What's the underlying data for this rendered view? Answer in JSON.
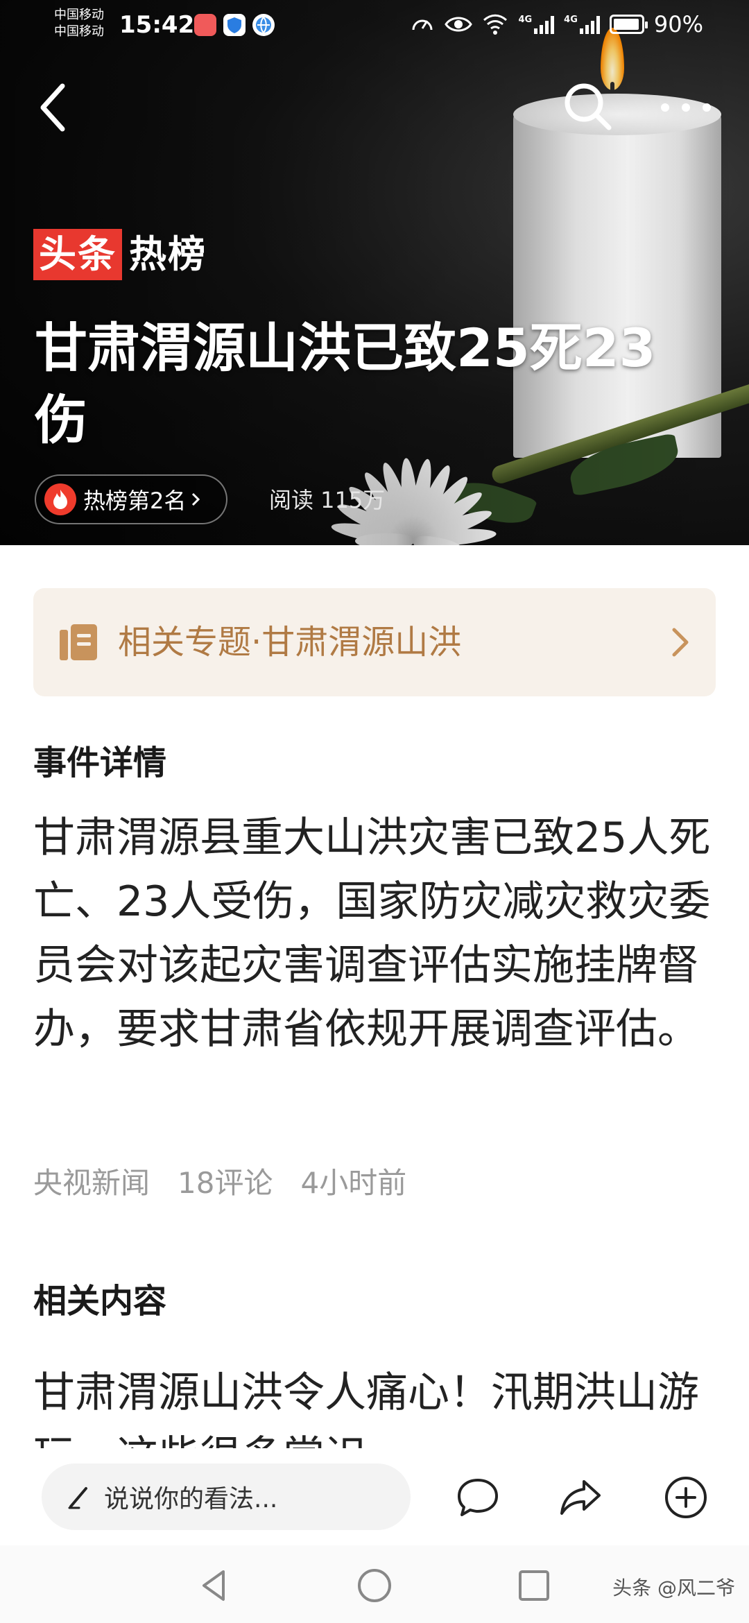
{
  "status_bar": {
    "carrier_1": "中国移动",
    "carrier_2": "中国移动",
    "time": "15:42",
    "network_1": "4G",
    "network_2": "4G",
    "battery": "90%"
  },
  "hero": {
    "brand_box": "头条",
    "brand_text": "热榜",
    "title": "甘肃渭源山洪已致25死23伤",
    "rank_label": "热榜第2名",
    "reads": "阅读 115万",
    "icons": {
      "back": "back-arrow-icon",
      "search": "search-icon",
      "more": "more-dots-icon"
    }
  },
  "topic": {
    "label": "相关专题·甘肃渭源山洪",
    "accent": "#b07a44",
    "background": "#f7f1ea"
  },
  "details": {
    "heading": "事件详情",
    "body": "甘肃渭源县重大山洪灾害已致25人死亡、23人受伤，国家防灾减灾救灾委员会对该起灾害调查评估实施挂牌督办，要求甘肃省依规开展调查评估。",
    "source": "央视新闻",
    "comments": "18评论",
    "time_ago": "4小时前"
  },
  "related": {
    "heading": "相关内容",
    "first_title": "甘肃渭源山洪令人痛心！汛期洪山游玩，这些很多常识"
  },
  "comment_bar": {
    "placeholder": "说说你的看法..."
  },
  "watermark": "头条 @风二爷",
  "colors": {
    "brand_red": "#e8382f",
    "fire_red": "#ef3b2c"
  }
}
